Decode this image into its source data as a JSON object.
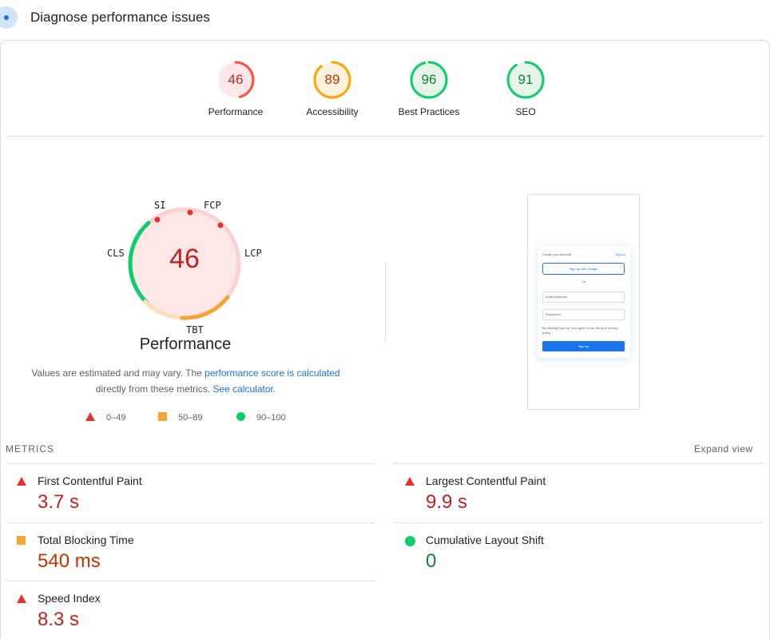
{
  "header": {
    "title": "Diagnose performance issues"
  },
  "categories": [
    {
      "score": "46",
      "label": "Performance",
      "value": 46,
      "color": "#ff4e42",
      "bg": "#fde8e7",
      "text": "#c5221f"
    },
    {
      "score": "89",
      "label": "Accessibility",
      "value": 89,
      "color": "#ffa400",
      "bg": "#fff3e0",
      "text": "#c33300"
    },
    {
      "score": "96",
      "label": "Best Practices",
      "value": 96,
      "color": "#0cce6b",
      "bg": "#e6f4ea",
      "text": "#188038"
    },
    {
      "score": "91",
      "label": "SEO",
      "value": 91,
      "color": "#0cce6b",
      "bg": "#e6f4ea",
      "text": "#188038"
    }
  ],
  "performance_gauge": {
    "score": "46",
    "title": "Performance",
    "tags": {
      "si": "SI",
      "fcp": "FCP",
      "lcp": "LCP",
      "tbt": "TBT",
      "cls": "CLS"
    }
  },
  "note": {
    "prefix": "Values are estimated and may vary. The ",
    "link1": "performance score is calculated",
    "middle": " directly from these metrics. ",
    "link2": "See calculator."
  },
  "legend": {
    "fail": "0–49",
    "average": "50–89",
    "pass": "90–100"
  },
  "screenshot": {
    "title": "Create your account",
    "signin": "Sign in",
    "google": "Sign up with Google",
    "or": "Or",
    "email": "Email Address*",
    "password": "Password*",
    "terms": "By clicking Sign Up, you agree to our terms & privacy policy",
    "button": "Sign up"
  },
  "metrics_section": {
    "label": "METRICS",
    "expand": "Expand view"
  },
  "metrics": [
    {
      "name": "First Contentful Paint",
      "value": "3.7 s",
      "status": "fail"
    },
    {
      "name": "Largest Contentful Paint",
      "value": "9.9 s",
      "status": "fail"
    },
    {
      "name": "Total Blocking Time",
      "value": "540 ms",
      "status": "average"
    },
    {
      "name": "Cumulative Layout Shift",
      "value": "0",
      "status": "pass"
    },
    {
      "name": "Speed Index",
      "value": "8.3 s",
      "status": "fail"
    }
  ]
}
